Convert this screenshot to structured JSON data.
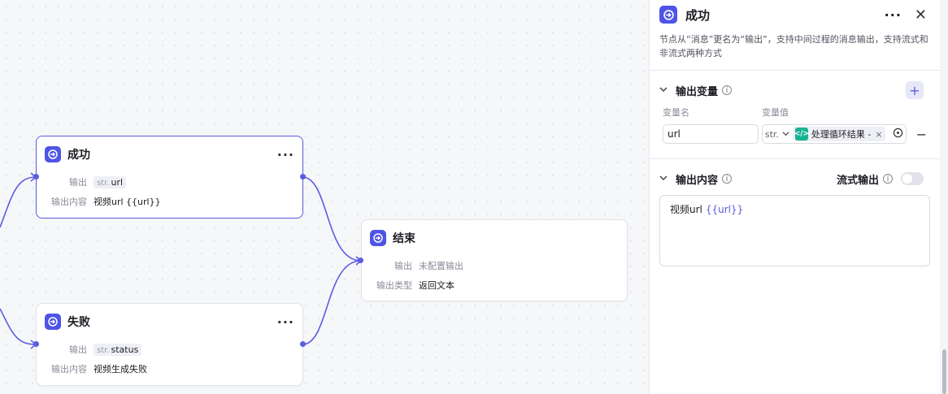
{
  "canvas": {
    "nodes": [
      {
        "title": "成功",
        "more": "···",
        "rows": [
          {
            "label": "输出",
            "type": "str.",
            "value": "url"
          },
          {
            "label": "输出内容",
            "value": "视频url {{url}}"
          }
        ]
      },
      {
        "title": "失败",
        "more": "···",
        "rows": [
          {
            "label": "输出",
            "type": "str.",
            "value": "status"
          },
          {
            "label": "输出内容",
            "value": "视频生成失败"
          }
        ]
      },
      {
        "title": "结束",
        "rows": [
          {
            "label": "输出",
            "value": "未配置输出"
          },
          {
            "label": "输出类型",
            "value": "返回文本"
          }
        ]
      }
    ]
  },
  "panel": {
    "title": "成功",
    "more": "···",
    "close": "✕",
    "description": "节点从“消息”更名为“输出”，支持中间过程的消息输出，支持流式和非流式两种方式",
    "output_vars": {
      "title": "输出变量",
      "add": "+",
      "col_name": "变量名",
      "col_value": "变量值",
      "row": {
        "name": "url",
        "type": "str.",
        "ref": "处理循环结果 -",
        "ref_close": "×",
        "remove": "−"
      }
    },
    "output_content": {
      "title": "输出内容",
      "stream_label": "流式输出",
      "stream_on": false,
      "content_text": "视频url",
      "content_var": "{{url}}"
    }
  },
  "colors": {
    "accent": "#5b5ce0",
    "icon_bg": "#4e54e6",
    "code_icon": "#1ab394"
  }
}
